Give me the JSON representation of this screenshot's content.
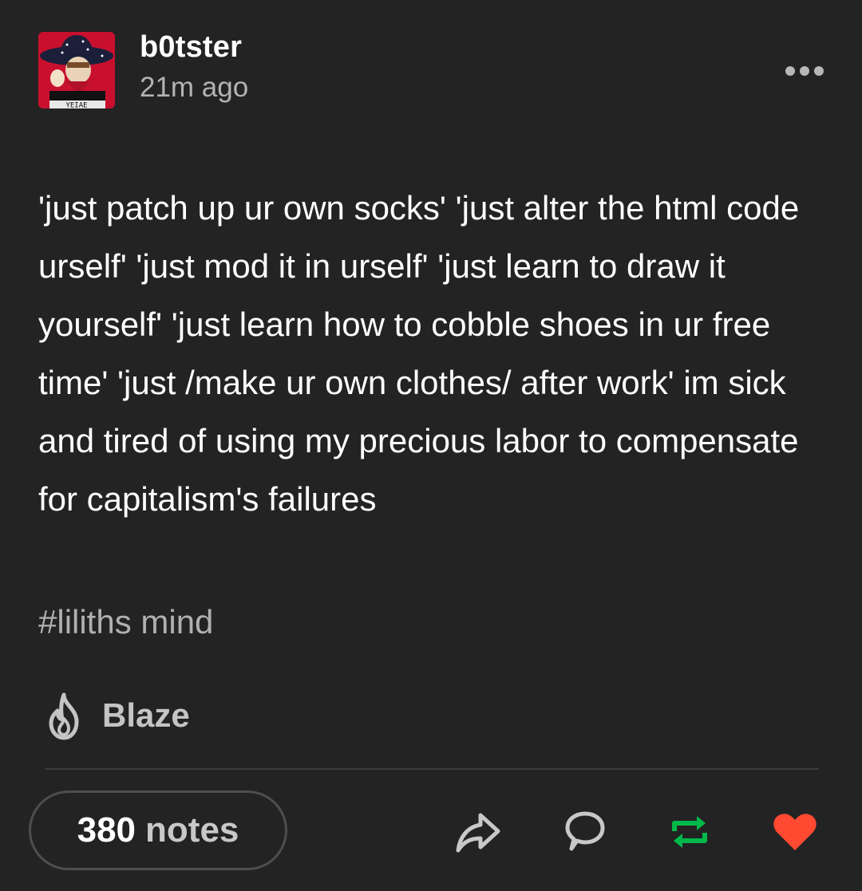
{
  "post": {
    "author": "b0tster",
    "timestamp": "21m ago",
    "avatar_label": "YEIAE",
    "body": "'just patch up ur own socks' 'just alter the html code urself' 'just mod it in urself' 'just learn to draw it yourself' 'just learn how to cobble shoes in ur free time' 'just /make ur own clothes/ after work' im sick and tired of using my precious labor to compensate for capitalism's failures",
    "tags": "#liliths mind"
  },
  "blaze": {
    "label": "Blaze",
    "icon": "flame-icon"
  },
  "footer": {
    "notes_count": "380",
    "notes_label": "notes",
    "actions": [
      {
        "icon": "share-icon",
        "color": "#c8c8c8"
      },
      {
        "icon": "reply-icon",
        "color": "#c8c8c8"
      },
      {
        "icon": "reblog-icon",
        "color": "#00b94a"
      },
      {
        "icon": "heart-icon",
        "color": "#ff4930"
      }
    ]
  },
  "colors": {
    "background": "#232323",
    "text": "#ffffff",
    "muted": "#b3b3b3",
    "reblog": "#00b94a",
    "like": "#ff4930"
  }
}
